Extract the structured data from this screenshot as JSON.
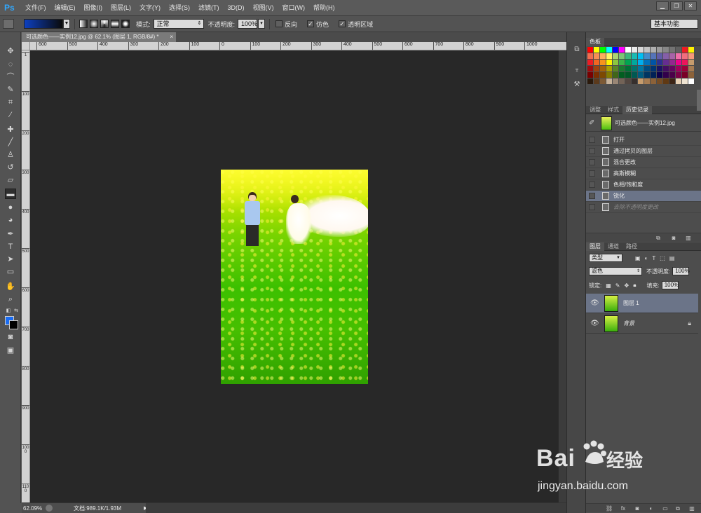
{
  "app": {
    "logo": "Ps",
    "menu": [
      "文件(F)",
      "编辑(E)",
      "图像(I)",
      "图层(L)",
      "文字(Y)",
      "选择(S)",
      "滤镜(T)",
      "3D(D)",
      "视图(V)",
      "窗口(W)",
      "帮助(H)"
    ],
    "window_controls": [
      "▁",
      "❐",
      "✕"
    ]
  },
  "options_bar": {
    "mode_label": "模式:",
    "mode_value": "正常",
    "opacity_label": "不透明度:",
    "opacity_value": "100%",
    "reverse_label": "反向",
    "dither_label": "仿色",
    "transparency_label": "透明区域",
    "dither_checked": "✓",
    "transparency_checked": "✓",
    "workspace": "基本功能",
    "gradient_colors": [
      "#0c3fbf",
      "#0a0a0a"
    ]
  },
  "tools": [
    "move-tool",
    "marquee-tool",
    "lasso-tool",
    "quick-select-tool",
    "crop-tool",
    "eyedropper-tool",
    "healing-brush-tool",
    "brush-tool",
    "clone-stamp-tool",
    "history-brush-tool",
    "eraser-tool",
    "gradient-tool",
    "blur-tool",
    "dodge-tool",
    "pen-tool",
    "type-tool",
    "path-select-tool",
    "shape-tool",
    "hand-tool",
    "zoom-tool"
  ],
  "colors": {
    "foreground": "#1a6cf2",
    "background": "#000000"
  },
  "document": {
    "tab_title": "可选颜色——实例12.jpg @ 62.1% (图层 1, RGB/8#) *",
    "tab_close": "×"
  },
  "rulers": {
    "h_ticks": [
      "600",
      "500",
      "400",
      "300",
      "200",
      "100",
      "0",
      "100",
      "200",
      "300",
      "400",
      "500",
      "600",
      "700",
      "800",
      "900",
      "1000"
    ],
    "v_ticks": [
      "1",
      "100",
      "200",
      "300",
      "400",
      "500",
      "600",
      "700",
      "800",
      "900",
      "1000",
      "1100"
    ]
  },
  "status": {
    "zoom": "62.09%",
    "doc_info": "文档:989.1K/1.93M",
    "arrow": "▶"
  },
  "swatch_panel": {
    "tab": "色板",
    "colors": [
      "#ff0000",
      "#ffff00",
      "#00ff00",
      "#00ffff",
      "#0000ff",
      "#ff00ff",
      "#ffffff",
      "#ebebeb",
      "#d7d7d7",
      "#c3c3c3",
      "#afafaf",
      "#9b9b9b",
      "#878787",
      "#737373",
      "#5f5f5f",
      "#ee1c24",
      "#fff200",
      "#f26c4f",
      "#f68e55",
      "#fbaf5c",
      "#fff467",
      "#acd372",
      "#7cc576",
      "#3bb878",
      "#1abbb4",
      "#00bff3",
      "#438ccb",
      "#5574b9",
      "#605ca8",
      "#855fa8",
      "#a763a8",
      "#f06ea9",
      "#f26d7d",
      "#f7977a",
      "#ed1c24",
      "#f26522",
      "#f7941d",
      "#fff200",
      "#8dc63f",
      "#39b54a",
      "#00a651",
      "#00a99d",
      "#00aeef",
      "#0072bc",
      "#0054a6",
      "#2e3192",
      "#662d91",
      "#92278f",
      "#ec008c",
      "#ed145b",
      "#c69c6d",
      "#9e0b0f",
      "#a0410d",
      "#a36209",
      "#aba000",
      "#598527",
      "#1a7b30",
      "#007236",
      "#00746b",
      "#0076a3",
      "#004b80",
      "#003471",
      "#1b1464",
      "#440e62",
      "#630460",
      "#9e005d",
      "#9e0039",
      "#a67c52",
      "#790000",
      "#7b2e00",
      "#7d4900",
      "#827b00",
      "#406618",
      "#005e20",
      "#005826",
      "#005952",
      "#005b7f",
      "#003663",
      "#002157",
      "#0d004c",
      "#32004b",
      "#4b0049",
      "#7b0046",
      "#7a0026",
      "#8c6239",
      "#2b1a0c",
      "#5b3a1c",
      "#7d5a35",
      "#c7b299",
      "#998675",
      "#736357",
      "#534741",
      "#362f2d",
      "#c69c6d",
      "#a67c52",
      "#8c6239",
      "#754c24",
      "#603913",
      "#3c2415",
      "#e6d0b5",
      "#efe4d2",
      "#ffffff"
    ]
  },
  "history_panel": {
    "tabs": [
      "调整",
      "样式",
      "历史记录"
    ],
    "active_tab": "历史记录",
    "snapshot": "可选颜色——实例12.jpg",
    "states": [
      {
        "label": "打开",
        "selected": false,
        "dim": false
      },
      {
        "label": "通过拷贝的图层",
        "selected": false,
        "dim": false
      },
      {
        "label": "混合更改",
        "selected": false,
        "dim": false
      },
      {
        "label": "高斯模糊",
        "selected": false,
        "dim": false
      },
      {
        "label": "色相/饱和度",
        "selected": false,
        "dim": false
      },
      {
        "label": "锐化",
        "selected": true,
        "dim": false
      },
      {
        "label": "去除不透明度更改",
        "selected": false,
        "dim": true
      }
    ]
  },
  "layers_panel": {
    "tabs": [
      "图层",
      "通道",
      "路径"
    ],
    "active_tab": "图层",
    "filter_kind": "类型",
    "blend_mode": "滤色",
    "opacity_label": "不透明度:",
    "opacity_value": "100%",
    "lock_label": "锁定:",
    "fill_label": "填充:",
    "fill_value": "100%",
    "layers": [
      {
        "name": "图层 1",
        "selected": true,
        "locked": false
      },
      {
        "name": "背景",
        "selected": false,
        "locked": true
      }
    ]
  },
  "watermark": {
    "brand": "Bai",
    "product": "经验",
    "url": "jingyan.baidu.com"
  }
}
